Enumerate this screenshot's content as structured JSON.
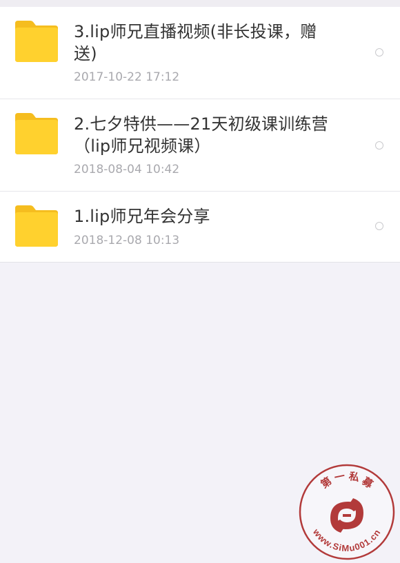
{
  "files": [
    {
      "name": "3.lip师兄直播视频(非长投课，赠送)",
      "date": "2017-10-22  17:12",
      "icon": "folder-icon",
      "selected": false
    },
    {
      "name": "2.七夕特供——21天初级课训练营（lip师兄视频课）",
      "date": "2018-08-04  10:42",
      "icon": "folder-icon",
      "selected": false
    },
    {
      "name": "1.lip师兄年会分享",
      "date": "2018-12-08  10:13",
      "icon": "folder-icon",
      "selected": false
    }
  ],
  "watermark": {
    "top_text": "第 一 私 募",
    "bottom_text": "www.SiMu001.cn"
  },
  "colors": {
    "folder": "#ffd12e",
    "folder_tab": "#f5bd1f",
    "background": "#f3f2f8",
    "name_text": "#333333",
    "date_text": "#a9a9ae",
    "watermark": "#b23a3a"
  }
}
